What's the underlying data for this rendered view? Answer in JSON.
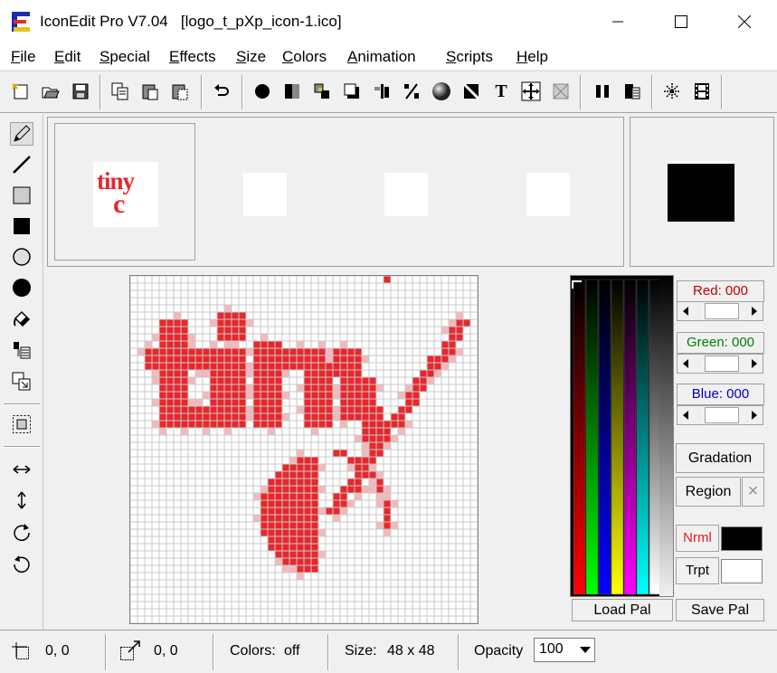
{
  "window": {
    "title": "IconEdit Pro V7.04   [logo_t_pXp_icon-1.ico]",
    "minimize_icon": "minimize-icon",
    "maximize_icon": "maximize-icon",
    "close_icon": "close-icon"
  },
  "menu": [
    {
      "label": "File",
      "ul": "F",
      "rest": "ile"
    },
    {
      "label": "Edit",
      "ul": "E",
      "rest": "dit"
    },
    {
      "label": "Special",
      "ul": "S",
      "rest": "pecial"
    },
    {
      "label": "Effects",
      "ul": "E",
      "rest": "ffects"
    },
    {
      "label": "Size",
      "ul": "S",
      "rest": "ize"
    },
    {
      "label": "Colors",
      "ul": "C",
      "rest": "olors"
    },
    {
      "label": "Animation",
      "ul": "A",
      "rest": "nimation"
    },
    {
      "label": "Scripts",
      "ul": "S",
      "rest": "cripts"
    },
    {
      "label": "Help",
      "ul": "H",
      "rest": "elp"
    }
  ],
  "preview": {
    "thumb_text_line1": "tiny",
    "thumb_text_line2": "c"
  },
  "color_panel": {
    "red_label": "Red: 000",
    "green_label": "Green: 000",
    "blue_label": "Blue: 000",
    "red_value": 0,
    "green_value": 0,
    "blue_value": 0,
    "gradation_label": "Gradation",
    "region_label": "Region",
    "region_close": "×",
    "nrml_label": "Nrml",
    "trpt_label": "Trpt",
    "nrml_color": "#000000",
    "trpt_color": "#ffffff",
    "load_pal": "Load Pal",
    "save_pal": "Save Pal"
  },
  "status": {
    "cursor_pos": "0, 0",
    "selection_size": "0, 0",
    "colors_label": "Colors:",
    "colors_value": "off",
    "size_label": "Size:",
    "size_value": "48 x 48",
    "opacity_label": "Opacity",
    "opacity_value": "100"
  },
  "colors": {
    "accent_red": "#e8272d",
    "pixel_light": "#f5b8ba",
    "grid": "#c8c8c8"
  }
}
